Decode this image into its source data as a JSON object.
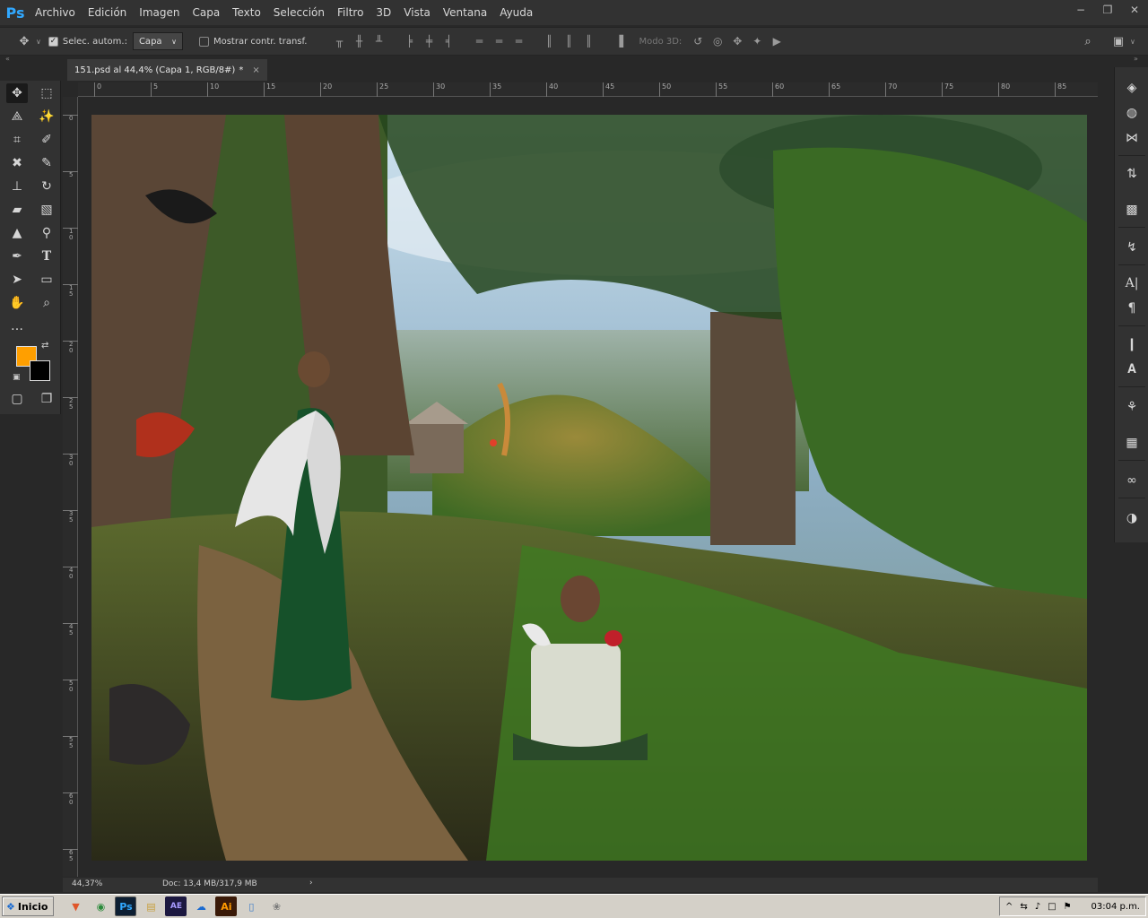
{
  "app": {
    "logo": "Ps"
  },
  "menu": [
    "Archivo",
    "Edición",
    "Imagen",
    "Capa",
    "Texto",
    "Selección",
    "Filtro",
    "3D",
    "Vista",
    "Ventana",
    "Ayuda"
  ],
  "options": {
    "auto_select_label": "Selec. autom.:",
    "auto_select_checked": true,
    "auto_select_value": "Capa",
    "show_transform_label": "Mostrar contr. transf.",
    "mode_3d_label": "Modo 3D:"
  },
  "document": {
    "tab_title": "151.psd al 44,4% (Capa 1, RGB/8#)",
    "modified_marker": "*",
    "close": "×"
  },
  "ruler_h": [
    "0",
    "5",
    "10",
    "15",
    "20",
    "25",
    "30",
    "35",
    "40",
    "45",
    "50",
    "55",
    "60",
    "65",
    "70",
    "75",
    "80",
    "85"
  ],
  "ruler_v": [
    "0",
    "5",
    "1 0",
    "1 5",
    "2 0",
    "2 5",
    "3 0",
    "3 5",
    "4 0",
    "4 5",
    "5 0",
    "5 5",
    "6 0",
    "6 5"
  ],
  "status": {
    "zoom": "44,37%",
    "doc_info": "Doc: 13,4 MB/317,9 MB",
    "arrow": "›"
  },
  "colors": {
    "foreground": "#ff9f00",
    "background": "#000000",
    "ui": "#323232"
  },
  "taskbar": {
    "start_label": "Inicio",
    "apps": [
      "brave-icon",
      "chrome-icon",
      "photoshop-icon",
      "folder-icon",
      "after-effects-icon",
      "onedrive-icon",
      "illustrator-icon",
      "notepad-icon",
      "paint-icon"
    ],
    "ps_label": "Ps",
    "ae_label": "AE",
    "ai_label": "Ai",
    "tray_arrow": "^",
    "clock": "03:04 p.m."
  }
}
